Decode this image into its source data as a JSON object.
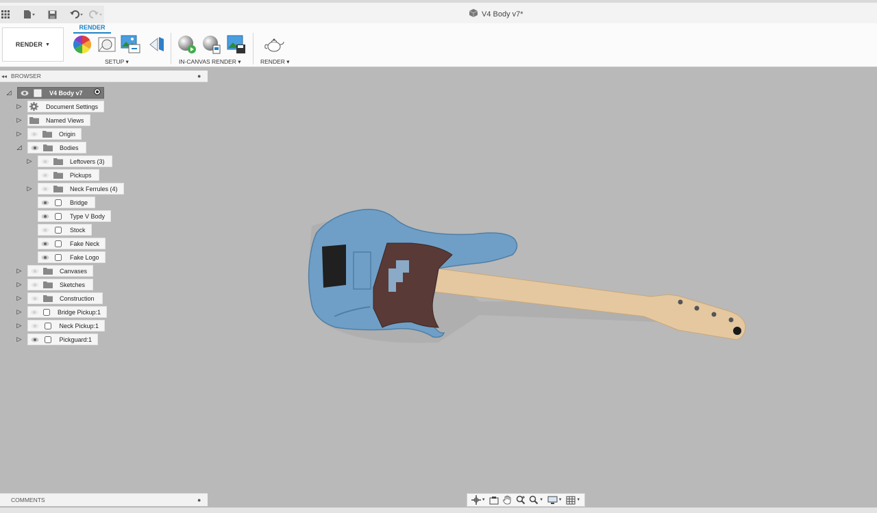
{
  "window": {
    "title": "V4 Body v7*"
  },
  "ribbon": {
    "workspace_label": "RENDER",
    "tab_label": "RENDER",
    "groups": {
      "setup": "SETUP",
      "in_canvas": "IN-CANVAS RENDER",
      "render": "RENDER"
    }
  },
  "browser": {
    "header": "BROWSER",
    "root": "V4 Body v7",
    "items": {
      "document_settings": "Document Settings",
      "named_views": "Named Views",
      "origin": "Origin",
      "bodies": "Bodies",
      "leftovers": "Leftovers (3)",
      "pickups": "Pickups",
      "neck_ferrules": "Neck Ferrules (4)",
      "bridge": "Bridge",
      "type_v_body": "Type V Body",
      "stock": "Stock",
      "fake_neck": "Fake Neck",
      "fake_logo": "Fake Logo",
      "canvases": "Canvases",
      "sketches": "Sketches",
      "construction": "Construction",
      "bridge_pickup": "Bridge Pickup:1",
      "neck_pickup": "Neck Pickup:1",
      "pickguard": "Pickguard:1"
    }
  },
  "comments": {
    "header": "COMMENTS"
  },
  "colors": {
    "canvas_bg": "#b9b9b9",
    "guitar_body": "#6f9fc6",
    "pickguard": "#5a3a36",
    "neck_wood": "#e5c8a0",
    "accent": "#1d82c5"
  }
}
